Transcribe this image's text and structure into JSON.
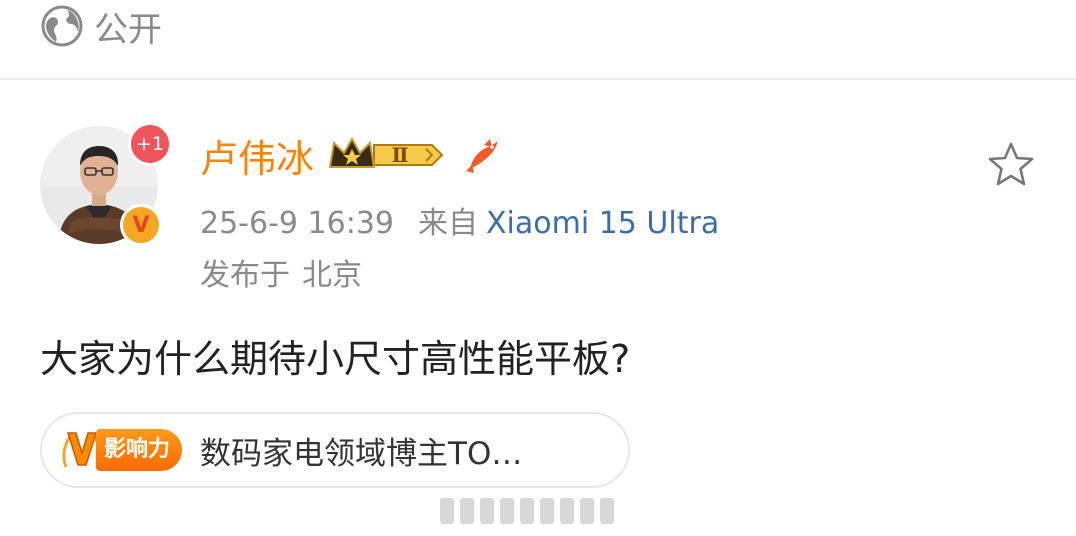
{
  "visibility": {
    "icon": "globe-icon",
    "label": "公开"
  },
  "author": {
    "name": "卢伟冰",
    "notification_count": "+1",
    "verified_badge": "V",
    "vip_level": "Ⅱ",
    "accent_color": "#ff8200"
  },
  "post": {
    "timestamp": "25-6-9 16:39",
    "from_label": "来自",
    "device": "Xiaomi 15 Ultra",
    "location_prefix": "发布于",
    "location": "北京",
    "text": "大家为什么期待小尺寸高性能平板?"
  },
  "influence": {
    "badge_letter": "V",
    "badge_text": "影响力",
    "label": "数码家电领域博主TO…"
  },
  "colors": {
    "device_link": "#3b6ea8",
    "muted_text": "#8a8a8a",
    "badge_red": "#f0545a"
  }
}
